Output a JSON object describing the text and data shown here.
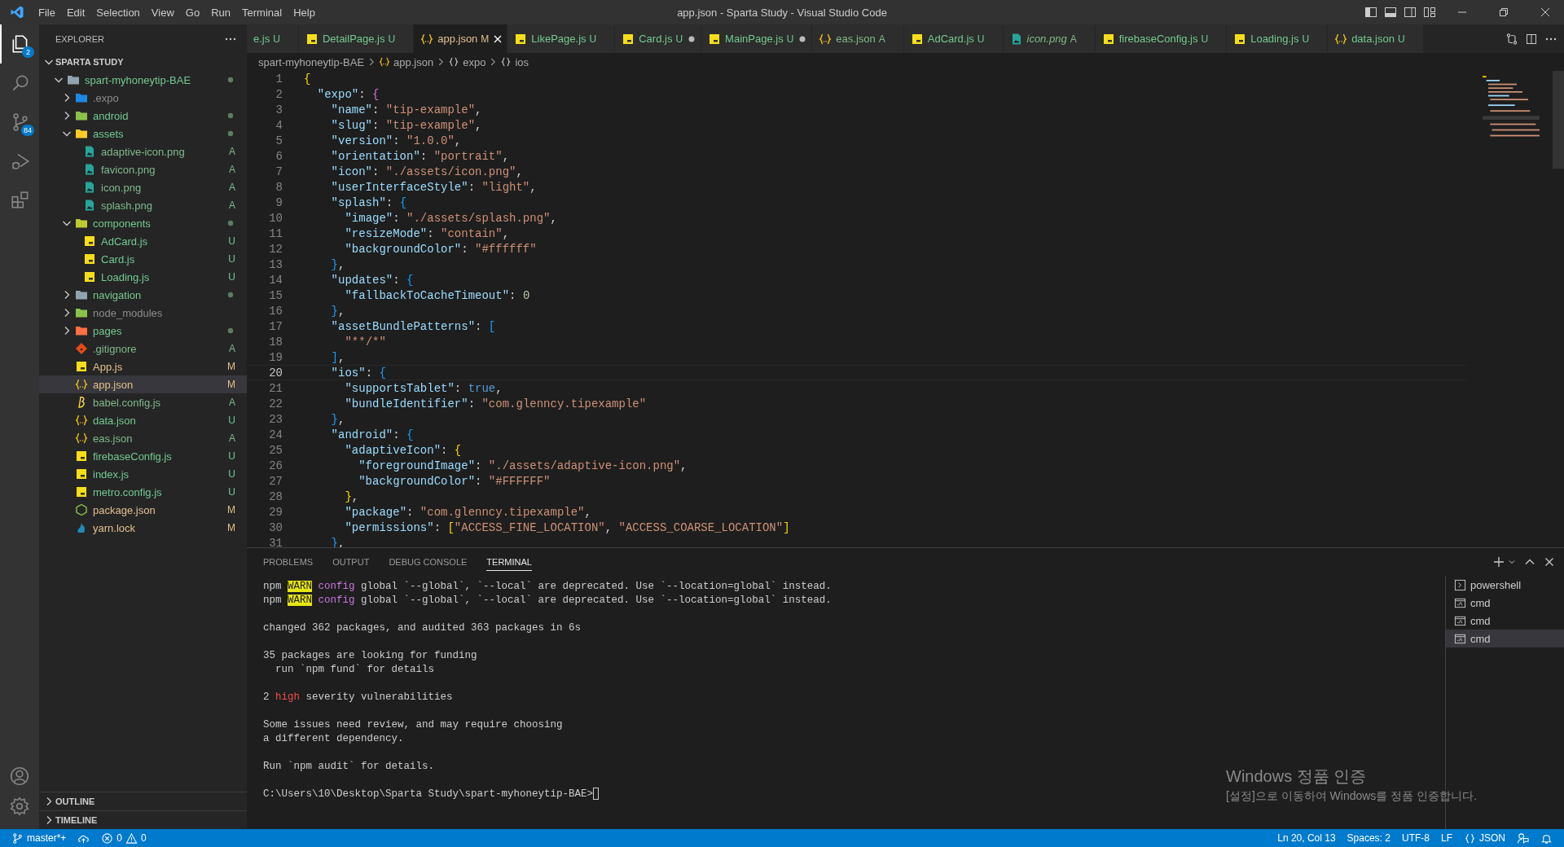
{
  "window": {
    "title": "app.json - Sparta Study - Visual Studio Code"
  },
  "menu": [
    "File",
    "Edit",
    "Selection",
    "View",
    "Go",
    "Run",
    "Terminal",
    "Help"
  ],
  "activity_bar": [
    {
      "kind": "explorer",
      "selected": true,
      "badge": "2"
    },
    {
      "kind": "search",
      "selected": false
    },
    {
      "kind": "source-control",
      "selected": false,
      "badge": "84"
    },
    {
      "kind": "run-debug",
      "selected": false
    },
    {
      "kind": "extensions",
      "selected": false
    }
  ],
  "activity_bar_bottom": [
    {
      "kind": "account"
    },
    {
      "kind": "settings"
    }
  ],
  "explorer": {
    "title": "EXPLORER",
    "section": {
      "title": "SPARTA STUDY",
      "expanded": true
    },
    "tree": [
      {
        "name": "spart-myhoneytip-BAE",
        "kind": "folder",
        "expanded": true,
        "color": "#73c991",
        "dot": true,
        "selected": false,
        "children": [
          {
            "name": ".expo",
            "kind": "expo-folder",
            "expanded": false,
            "color": "#8c8c8c",
            "dot": false,
            "selected": false
          },
          {
            "name": "android",
            "kind": "android-folder",
            "expanded": false,
            "color": "#73c991",
            "dot": true,
            "selected": false
          },
          {
            "name": "assets",
            "kind": "assets-folder",
            "expanded": true,
            "color": "#73c991",
            "dot": true,
            "selected": false,
            "children": [
              {
                "name": "adaptive-icon.png",
                "kind": "image",
                "color": "#81b88b",
                "badge": "A",
                "selected": false
              },
              {
                "name": "favicon.png",
                "kind": "image",
                "color": "#81b88b",
                "badge": "A",
                "selected": false
              },
              {
                "name": "icon.png",
                "kind": "image",
                "color": "#81b88b",
                "badge": "A",
                "selected": false
              },
              {
                "name": "splash.png",
                "kind": "image",
                "color": "#81b88b",
                "badge": "A",
                "selected": false
              }
            ]
          },
          {
            "name": "components",
            "kind": "components-folder",
            "expanded": true,
            "color": "#73c991",
            "dot": true,
            "selected": false,
            "children": [
              {
                "name": "AdCard.js",
                "kind": "js",
                "color": "#73c991",
                "badge": "U",
                "selected": false
              },
              {
                "name": "Card.js",
                "kind": "js",
                "color": "#73c991",
                "badge": "U",
                "selected": false
              },
              {
                "name": "Loading.js",
                "kind": "js",
                "color": "#73c991",
                "badge": "U",
                "selected": false
              }
            ]
          },
          {
            "name": "navigation",
            "kind": "folder",
            "expanded": false,
            "color": "#73c991",
            "dot": true,
            "selected": false
          },
          {
            "name": "node_modules",
            "kind": "node-folder",
            "expanded": false,
            "color": "#8c8c8c",
            "dot": false,
            "selected": false
          },
          {
            "name": "pages",
            "kind": "pages-folder",
            "expanded": false,
            "color": "#73c991",
            "dot": true,
            "selected": false
          },
          {
            "name": ".gitignore",
            "kind": "git",
            "color": "#81b88b",
            "badge": "A",
            "selected": false
          },
          {
            "name": "App.js",
            "kind": "js",
            "color": "#e2c08d",
            "badge": "M",
            "selected": false
          },
          {
            "name": "app.json",
            "kind": "json",
            "color": "#e2c08d",
            "badge": "M",
            "selected": true
          },
          {
            "name": "babel.config.js",
            "kind": "babel",
            "color": "#81b88b",
            "badge": "A",
            "selected": false
          },
          {
            "name": "data.json",
            "kind": "json",
            "color": "#73c991",
            "badge": "U",
            "selected": false
          },
          {
            "name": "eas.json",
            "kind": "json",
            "color": "#81b88b",
            "badge": "A",
            "selected": false
          },
          {
            "name": "firebaseConfig.js",
            "kind": "js",
            "color": "#73c991",
            "badge": "U",
            "selected": false
          },
          {
            "name": "index.js",
            "kind": "js",
            "color": "#73c991",
            "badge": "U",
            "selected": false
          },
          {
            "name": "metro.config.js",
            "kind": "js",
            "color": "#73c991",
            "badge": "U",
            "selected": false
          },
          {
            "name": "package.json",
            "kind": "node",
            "color": "#e2c08d",
            "badge": "M",
            "selected": false
          },
          {
            "name": "yarn.lock",
            "kind": "yarn",
            "color": "#e2c08d",
            "badge": "M",
            "selected": false
          }
        ]
      }
    ],
    "collapsed_sections": [
      {
        "title": "OUTLINE",
        "expanded": false
      },
      {
        "title": "TIMELINE",
        "expanded": false
      }
    ]
  },
  "tabs": [
    {
      "label": "e.js",
      "kind": "none",
      "color": "#73c991",
      "badge": "U",
      "selected": false,
      "dirty": false,
      "preview": false
    },
    {
      "label": "DetailPage.js",
      "kind": "js",
      "color": "#73c991",
      "badge": "U",
      "selected": false,
      "dirty": false,
      "preview": false
    },
    {
      "label": "app.json",
      "kind": "json",
      "color": "#e2c08d",
      "badge": "M",
      "selected": true,
      "dirty": false,
      "preview": false
    },
    {
      "label": "LikePage.js",
      "kind": "js",
      "color": "#73c991",
      "badge": "U",
      "selected": false,
      "dirty": false,
      "preview": false
    },
    {
      "label": "Card.js",
      "kind": "js",
      "color": "#73c991",
      "badge": "U",
      "selected": false,
      "dirty": true,
      "preview": false
    },
    {
      "label": "MainPage.js",
      "kind": "js",
      "color": "#73c991",
      "badge": "U",
      "selected": false,
      "dirty": true,
      "preview": false
    },
    {
      "label": "eas.json",
      "kind": "json",
      "color": "#81b88b",
      "badge": "A",
      "selected": false,
      "dirty": false,
      "preview": false
    },
    {
      "label": "AdCard.js",
      "kind": "js",
      "color": "#73c991",
      "badge": "U",
      "selected": false,
      "dirty": false,
      "preview": false
    },
    {
      "label": "icon.png",
      "kind": "image",
      "color": "#81b88b",
      "badge": "A",
      "selected": false,
      "dirty": false,
      "preview": true
    },
    {
      "label": "firebaseConfig.js",
      "kind": "js",
      "color": "#73c991",
      "badge": "U",
      "selected": false,
      "dirty": false,
      "preview": false
    },
    {
      "label": "Loading.js",
      "kind": "js",
      "color": "#73c991",
      "badge": "U",
      "selected": false,
      "dirty": false,
      "preview": false
    },
    {
      "label": "data.json",
      "kind": "json",
      "color": "#73c991",
      "badge": "U",
      "selected": false,
      "dirty": false,
      "preview": false
    }
  ],
  "breadcrumbs": [
    {
      "kind": "folder",
      "label": "spart-myhoneytip-BAE"
    },
    {
      "kind": "json",
      "label": "app.json"
    },
    {
      "kind": "object",
      "label": "expo"
    },
    {
      "kind": "object",
      "label": "ios"
    }
  ],
  "editor": {
    "lines": [
      {
        "n": "1",
        "text": "{",
        "current": false
      },
      {
        "n": "2",
        "text": "  \"expo\": {",
        "current": false
      },
      {
        "n": "3",
        "text": "    \"name\": \"tip-example\",",
        "current": false
      },
      {
        "n": "4",
        "text": "    \"slug\": \"tip-example\",",
        "current": false
      },
      {
        "n": "5",
        "text": "    \"version\": \"1.0.0\",",
        "current": false
      },
      {
        "n": "6",
        "text": "    \"orientation\": \"portrait\",",
        "current": false
      },
      {
        "n": "7",
        "text": "    \"icon\": \"./assets/icon.png\",",
        "current": false
      },
      {
        "n": "8",
        "text": "    \"userInterfaceStyle\": \"light\",",
        "current": false
      },
      {
        "n": "9",
        "text": "    \"splash\": {",
        "current": false
      },
      {
        "n": "10",
        "text": "      \"image\": \"./assets/splash.png\",",
        "current": false
      },
      {
        "n": "11",
        "text": "      \"resizeMode\": \"contain\",",
        "current": false
      },
      {
        "n": "12",
        "text": "      \"backgroundColor\": \"#ffffff\"",
        "current": false
      },
      {
        "n": "13",
        "text": "    },",
        "current": false
      },
      {
        "n": "14",
        "text": "    \"updates\": {",
        "current": false
      },
      {
        "n": "15",
        "text": "      \"fallbackToCacheTimeout\": 0",
        "current": false
      },
      {
        "n": "16",
        "text": "    },",
        "current": false
      },
      {
        "n": "17",
        "text": "    \"assetBundlePatterns\": [",
        "current": false
      },
      {
        "n": "18",
        "text": "      \"**/*\"",
        "current": false
      },
      {
        "n": "19",
        "text": "    ],",
        "current": false
      },
      {
        "n": "20",
        "text": "    \"ios\": {",
        "current": true
      },
      {
        "n": "21",
        "text": "      \"supportsTablet\": true,",
        "current": false
      },
      {
        "n": "22",
        "text": "      \"bundleIdentifier\": \"com.glenncy.tipexample\"",
        "current": false
      },
      {
        "n": "23",
        "text": "    },",
        "current": false
      },
      {
        "n": "24",
        "text": "    \"android\": {",
        "current": false
      },
      {
        "n": "25",
        "text": "      \"adaptiveIcon\": {",
        "current": false
      },
      {
        "n": "26",
        "text": "        \"foregroundImage\": \"./assets/adaptive-icon.png\",",
        "current": false
      },
      {
        "n": "27",
        "text": "        \"backgroundColor\": \"#FFFFFF\"",
        "current": false
      },
      {
        "n": "28",
        "text": "      },",
        "current": false
      },
      {
        "n": "29",
        "text": "      \"package\": \"com.glenncy.tipexample\",",
        "current": false
      },
      {
        "n": "30",
        "text": "      \"permissions\": [\"ACCESS_FINE_LOCATION\", \"ACCESS_COARSE_LOCATION\"]",
        "current": false
      },
      {
        "n": "31",
        "text": "    },",
        "current": false
      }
    ]
  },
  "panel": {
    "tabs": [
      {
        "label": "PROBLEMS",
        "selected": false
      },
      {
        "label": "OUTPUT",
        "selected": false
      },
      {
        "label": "DEBUG CONSOLE",
        "selected": false
      },
      {
        "label": "TERMINAL",
        "selected": true
      }
    ],
    "terminal": {
      "blocks": [
        [
          {
            "segments": [
              {
                "kind": "plain",
                "text": "npm "
              },
              {
                "kind": "warn",
                "text": "WARN"
              },
              {
                "kind": "keyword",
                "text": " config"
              },
              {
                "kind": "plain",
                "text": " global `--global`, `--local` are deprecated. Use `--location=global` instead."
              }
            ]
          },
          {
            "segments": [
              {
                "kind": "plain",
                "text": "npm "
              },
              {
                "kind": "warn",
                "text": "WARN"
              },
              {
                "kind": "keyword",
                "text": " config"
              },
              {
                "kind": "plain",
                "text": " global `--global`, `--local` are deprecated. Use `--location=global` instead."
              }
            ]
          }
        ],
        [
          {
            "segments": [
              {
                "kind": "plain",
                "text": "changed 362 packages, and audited 363 packages in 6s"
              }
            ]
          }
        ],
        [
          {
            "segments": [
              {
                "kind": "plain",
                "text": "35 packages are looking for funding"
              }
            ]
          },
          {
            "segments": [
              {
                "kind": "plain",
                "text": "  run `npm fund` for details"
              }
            ]
          }
        ],
        [
          {
            "segments": [
              {
                "kind": "plain",
                "text": "2 "
              },
              {
                "kind": "danger",
                "text": "high"
              },
              {
                "kind": "plain",
                "text": " severity vulnerabilities"
              }
            ]
          }
        ],
        [
          {
            "segments": [
              {
                "kind": "plain",
                "text": "Some issues need review, and may require choosing"
              }
            ]
          },
          {
            "segments": [
              {
                "kind": "plain",
                "text": "a different dependency."
              }
            ]
          }
        ],
        [
          {
            "segments": [
              {
                "kind": "plain",
                "text": "Run `npm audit` for details."
              }
            ]
          }
        ],
        [
          {
            "segments": [
              {
                "kind": "plain",
                "text": "C:\\Users\\10\\Desktop\\Sparta Study\\spart-myhoneytip-BAE>"
              }
            ],
            "cursor": true
          }
        ]
      ]
    },
    "terminals": [
      {
        "kind": "powershell",
        "label": "powershell",
        "selected": false
      },
      {
        "kind": "cmd",
        "label": "cmd",
        "selected": false
      },
      {
        "kind": "cmd",
        "label": "cmd",
        "selected": false
      },
      {
        "kind": "cmd",
        "label": "cmd",
        "selected": true
      }
    ]
  },
  "status_bar": {
    "branch": "master*+",
    "errors": "0",
    "warnings": "0",
    "position": "Ln 20, Col 13",
    "indent": "Spaces: 2",
    "encoding": "UTF-8",
    "eol": "LF",
    "language": "JSON"
  },
  "activation_notice": {
    "title": "Windows 정품 인증",
    "text": "[설정]으로 이동하여 Windows를 정품 인증합니다."
  }
}
